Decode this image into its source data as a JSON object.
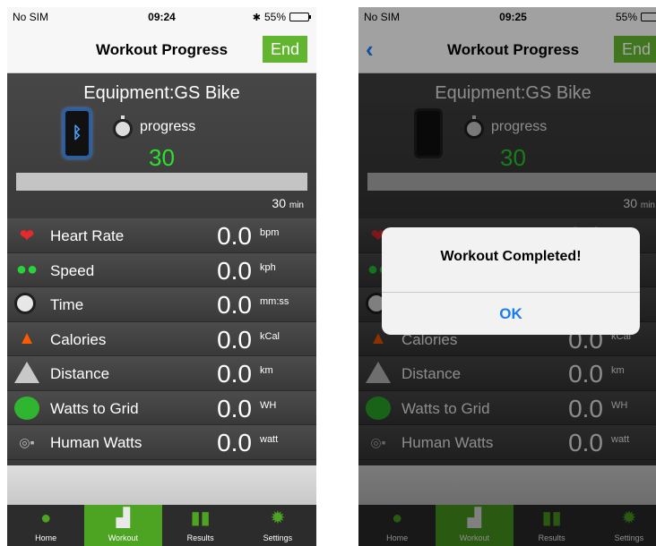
{
  "left": {
    "status": {
      "carrier": "No SIM",
      "time": "09:24",
      "battery": "55%"
    },
    "nav": {
      "title": "Workout Progress",
      "end_label": "End"
    },
    "equipment": "Equipment:GS Bike",
    "progress_label": "progress",
    "progress_value": "30",
    "progress_fraction": 1.0,
    "duration_value": "30",
    "duration_unit": "min"
  },
  "right": {
    "status": {
      "carrier": "No SIM",
      "time": "09:25",
      "battery": "55%"
    },
    "nav": {
      "title": "Workout Progress",
      "end_label": "End"
    },
    "equipment": "Equipment:GS Bike",
    "progress_label": "progress",
    "progress_value": "30",
    "progress_fraction": 1.0,
    "duration_value": "30",
    "duration_unit": "min",
    "alert": {
      "title": "Workout Completed!",
      "ok_label": "OK"
    }
  },
  "metrics": [
    {
      "label": "Heart Rate",
      "value": "0.0",
      "unit": "bpm",
      "icon": "heart-icon"
    },
    {
      "label": "Speed",
      "value": "0.0",
      "unit": "kph",
      "icon": "footprints-icon"
    },
    {
      "label": "Time",
      "value": "0.0",
      "unit": "mm:ss",
      "icon": "stopwatch-icon"
    },
    {
      "label": "Calories",
      "value": "0.0",
      "unit": "kCal",
      "icon": "flame-icon"
    },
    {
      "label": "Distance",
      "value": "0.0",
      "unit": "km",
      "icon": "road-icon"
    },
    {
      "label": "Watts to Grid",
      "value": "0.0",
      "unit": "WH",
      "icon": "grid-power-icon"
    },
    {
      "label": "Human Watts",
      "value": "0.0",
      "unit": "watt",
      "icon": "human-watts-icon"
    }
  ],
  "tabs": [
    {
      "label": "Home",
      "icon": "home-icon"
    },
    {
      "label": "Workout",
      "icon": "workout-icon"
    },
    {
      "label": "Results",
      "icon": "results-icon"
    },
    {
      "label": "Settings",
      "icon": "settings-icon"
    }
  ],
  "colors": {
    "accent": "#62b52e",
    "progress_text": "#2ee02e",
    "link": "#1a7cf0"
  }
}
